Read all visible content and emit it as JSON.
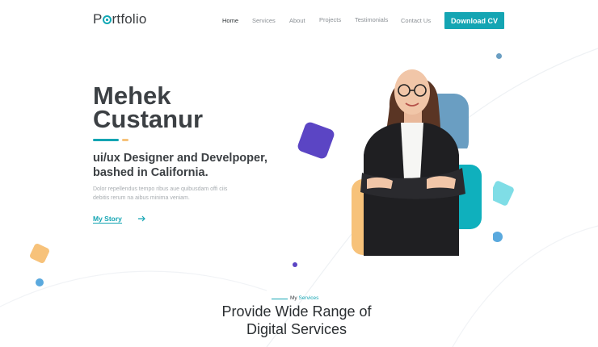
{
  "brand": {
    "logo_prefix": "P",
    "logo_suffix": "rtfolio"
  },
  "nav": {
    "items": [
      {
        "label": "Home"
      },
      {
        "label": "Services"
      },
      {
        "label": "About"
      },
      {
        "label": "Projects"
      },
      {
        "label": "Testimonials"
      },
      {
        "label": "Contact Us"
      }
    ],
    "cta_label": "Download CV"
  },
  "hero": {
    "first_name": "Mehek",
    "last_name": "Custanur",
    "role_line1": "ui/ux Designer and Develpoper,",
    "role_line2": "bashed in California.",
    "desc_line1": "Dolor repellendus tempo ribus aue quibusdam offi ciis",
    "desc_line2": "debitis rerum na aibus minima veniam.",
    "story_label": "My Story",
    "arrow_icon": "arrow-right-icon"
  },
  "services": {
    "kicker_prefix": "My",
    "kicker_highlight": "Services",
    "title_line1": "Provide Wide Range of",
    "title_line2": "Digital Services"
  },
  "colors": {
    "accent": "#14a5b3",
    "purple": "#5b45c4",
    "yellow": "#f7c27a",
    "steel_blue": "#6a9ec2",
    "light_teal": "#7fdde6",
    "sky_blue": "#5aa9de"
  }
}
